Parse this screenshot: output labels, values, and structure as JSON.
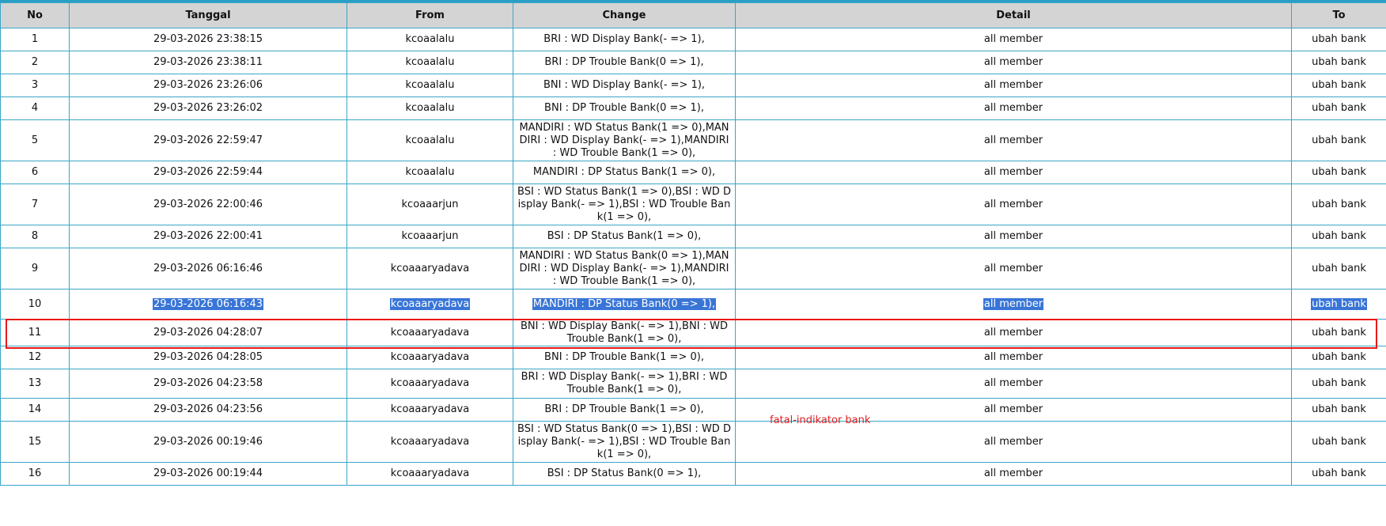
{
  "headers": {
    "no": "No",
    "tanggal": "Tanggal",
    "from": "From",
    "change": "Change",
    "detail": "Detail",
    "to": "To"
  },
  "rows": [
    {
      "no": "1",
      "tanggal": "29-03-2026 23:38:15",
      "from": "kcoaalalu",
      "change": "BRI : WD Display Bank(- => 1),",
      "detail": "all member",
      "to": "ubah bank"
    },
    {
      "no": "2",
      "tanggal": "29-03-2026 23:38:11",
      "from": "kcoaalalu",
      "change": "BRI : DP Trouble Bank(0 => 1),",
      "detail": "all member",
      "to": "ubah bank"
    },
    {
      "no": "3",
      "tanggal": "29-03-2026 23:26:06",
      "from": "kcoaalalu",
      "change": "BNI : WD Display Bank(- => 1),",
      "detail": "all member",
      "to": "ubah bank"
    },
    {
      "no": "4",
      "tanggal": "29-03-2026 23:26:02",
      "from": "kcoaalalu",
      "change": "BNI : DP Trouble Bank(0 => 1),",
      "detail": "all member",
      "to": "ubah bank"
    },
    {
      "no": "5",
      "tanggal": "29-03-2026 22:59:47",
      "from": "kcoaalalu",
      "change": "MANDIRI : WD Status Bank(1 => 0),MANDIRI : WD Display Bank(- => 1),MANDIRI : WD Trouble Bank(1 => 0),",
      "detail": "all member",
      "to": "ubah bank"
    },
    {
      "no": "6",
      "tanggal": "29-03-2026 22:59:44",
      "from": "kcoaalalu",
      "change": "MANDIRI : DP Status Bank(1 => 0),",
      "detail": "all member",
      "to": "ubah bank"
    },
    {
      "no": "7",
      "tanggal": "29-03-2026 22:00:46",
      "from": "kcoaaarjun",
      "change": "BSI : WD Status Bank(1 => 0),BSI : WD Display Bank(- => 1),BSI : WD Trouble Bank(1 => 0),",
      "detail": "all member",
      "to": "ubah bank"
    },
    {
      "no": "8",
      "tanggal": "29-03-2026 22:00:41",
      "from": "kcoaaarjun",
      "change": "BSI : DP Status Bank(1 => 0),",
      "detail": "all member",
      "to": "ubah bank"
    },
    {
      "no": "9",
      "tanggal": "29-03-2026 06:16:46",
      "from": "kcoaaaryadava",
      "change": "MANDIRI : WD Status Bank(0 => 1),MANDIRI : WD Display Bank(- => 1),MANDIRI : WD Trouble Bank(1 => 0),",
      "detail": "all member",
      "to": "ubah bank"
    },
    {
      "no": "10",
      "tanggal": "29-03-2026 06:16:43",
      "from": "kcoaaaryadava",
      "change": "MANDIRI : DP Status Bank(0 => 1),",
      "detail": "all member",
      "to": "ubah bank"
    },
    {
      "no": "11",
      "tanggal": "29-03-2026 04:28:07",
      "from": "kcoaaaryadava",
      "change": "BNI : WD Display Bank(- => 1),BNI : WD Trouble Bank(1 => 0),",
      "detail": "all member",
      "to": "ubah bank"
    },
    {
      "no": "12",
      "tanggal": "29-03-2026 04:28:05",
      "from": "kcoaaaryadava",
      "change": "BNI : DP Trouble Bank(1 => 0),",
      "detail": "all member",
      "to": "ubah bank"
    },
    {
      "no": "13",
      "tanggal": "29-03-2026 04:23:58",
      "from": "kcoaaaryadava",
      "change": "BRI : WD Display Bank(- => 1),BRI : WD Trouble Bank(1 => 0),",
      "detail": "all member",
      "to": "ubah bank"
    },
    {
      "no": "14",
      "tanggal": "29-03-2026 04:23:56",
      "from": "kcoaaaryadava",
      "change": "BRI : DP Trouble Bank(1 => 0),",
      "detail": "all member",
      "to": "ubah bank"
    },
    {
      "no": "15",
      "tanggal": "29-03-2026 00:19:46",
      "from": "kcoaaaryadava",
      "change": "BSI : WD Status Bank(0 => 1),BSI : WD Display Bank(- => 1),BSI : WD Trouble Bank(1 => 0),",
      "detail": "all member",
      "to": "ubah bank"
    },
    {
      "no": "16",
      "tanggal": "29-03-2026 00:19:44",
      "from": "kcoaaaryadava",
      "change": "BSI : DP Status Bank(0 => 1),",
      "detail": "all member",
      "to": "ubah bank"
    }
  ],
  "annotation": "fatal-indikator bank",
  "colors": {
    "border": "#3aa6c6",
    "header_bg": "#d4d4d4",
    "selection": "#3875d7",
    "highlight_box": "#e81818",
    "annotation": "#e02020"
  }
}
